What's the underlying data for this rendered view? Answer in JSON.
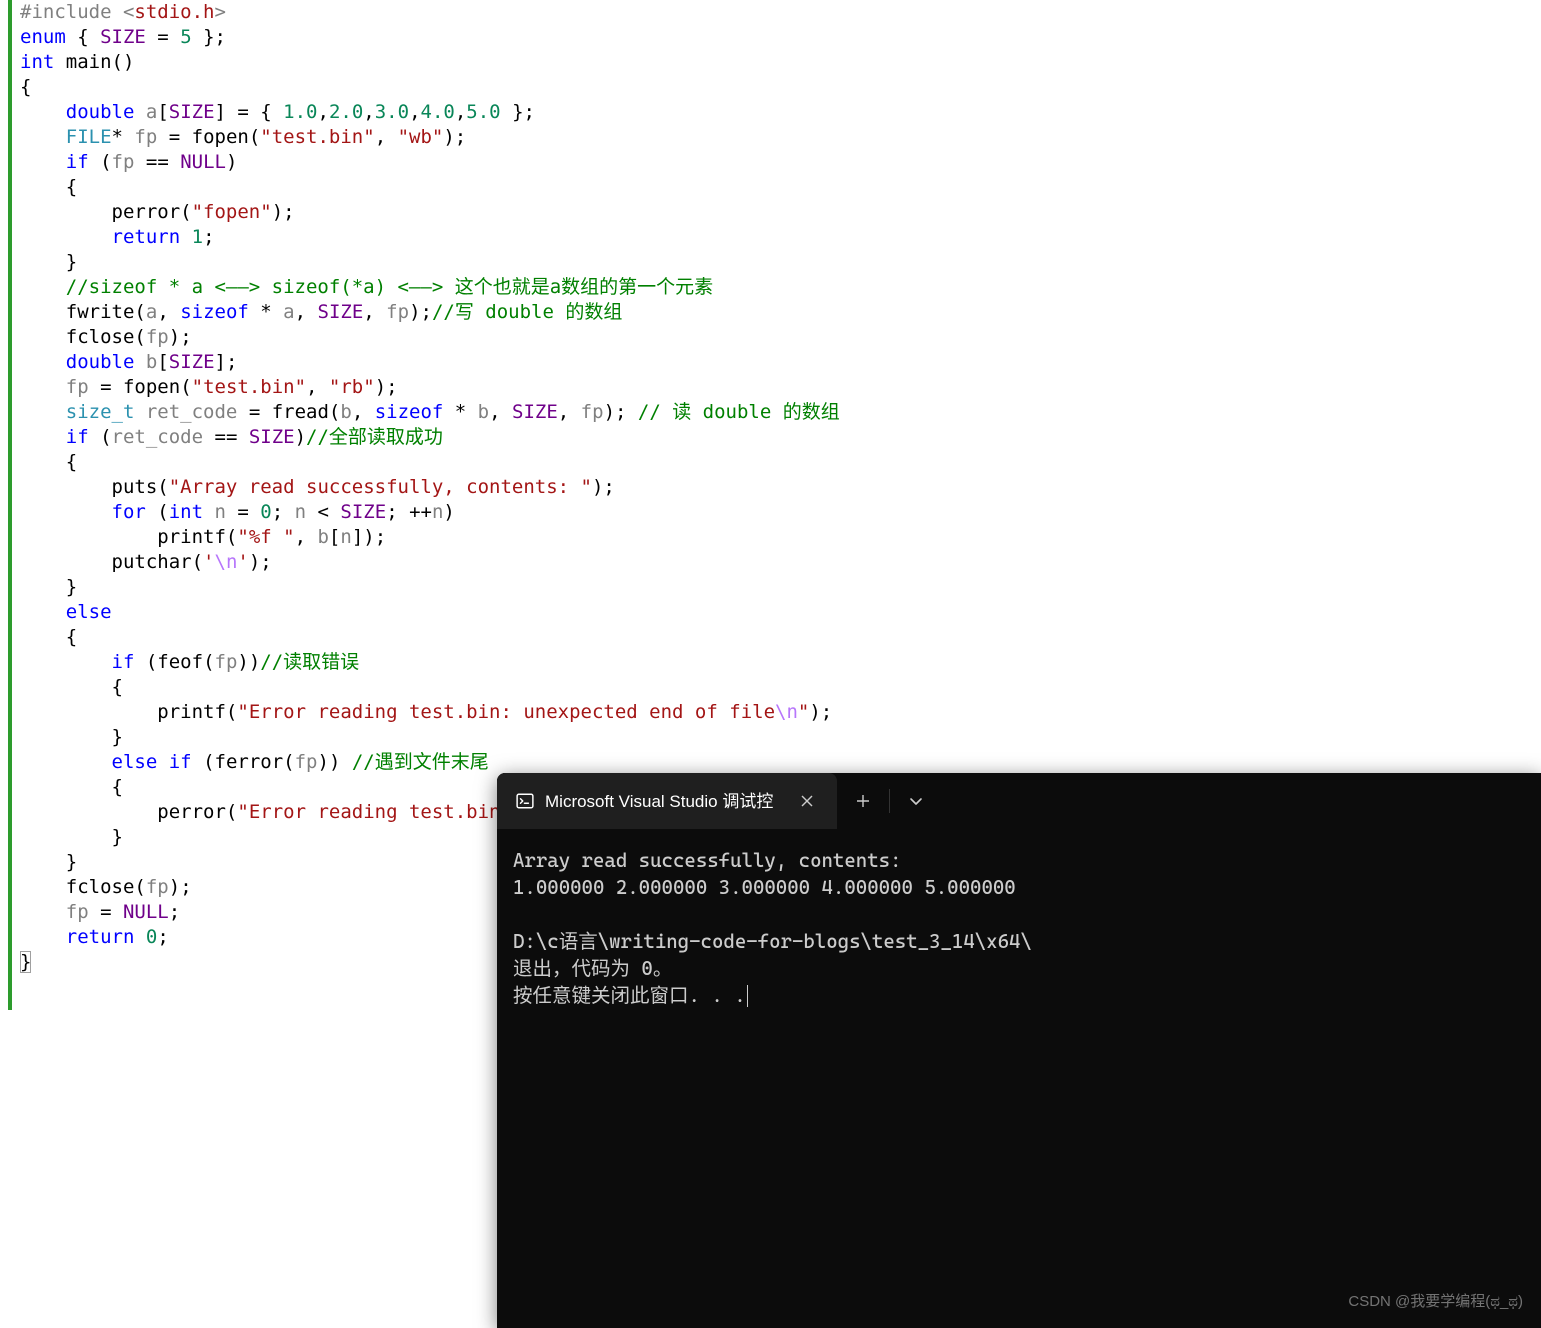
{
  "code": {
    "lines": [
      {
        "tokens": [
          [
            "pp",
            "#include "
          ],
          [
            "angle",
            "<"
          ],
          [
            "inc",
            "stdio.h"
          ],
          [
            "angle",
            ">"
          ]
        ]
      },
      {
        "tokens": [
          [
            "kw",
            "enum"
          ],
          [
            "op",
            " { "
          ],
          [
            "macro",
            "SIZE"
          ],
          [
            "op",
            " = "
          ],
          [
            "num",
            "5"
          ],
          [
            "op",
            " };"
          ]
        ]
      },
      {
        "tokens": [
          [
            "kw",
            "int"
          ],
          [
            "op",
            " "
          ],
          [
            "fn",
            "main"
          ],
          [
            "op",
            "()"
          ]
        ]
      },
      {
        "tokens": [
          [
            "op",
            "{"
          ]
        ]
      },
      {
        "tokens": [
          [
            "op",
            "    "
          ],
          [
            "kw",
            "double"
          ],
          [
            "op",
            " "
          ],
          [
            "id",
            "a"
          ],
          [
            "op",
            "["
          ],
          [
            "macro",
            "SIZE"
          ],
          [
            "op",
            "] = { "
          ],
          [
            "num",
            "1.0"
          ],
          [
            "op",
            ","
          ],
          [
            "num",
            "2.0"
          ],
          [
            "op",
            ","
          ],
          [
            "num",
            "3.0"
          ],
          [
            "op",
            ","
          ],
          [
            "num",
            "4.0"
          ],
          [
            "op",
            ","
          ],
          [
            "num",
            "5.0"
          ],
          [
            "op",
            " };"
          ]
        ]
      },
      {
        "tokens": [
          [
            "op",
            "    "
          ],
          [
            "up",
            "FILE"
          ],
          [
            "op",
            "* "
          ],
          [
            "id",
            "fp"
          ],
          [
            "op",
            " = "
          ],
          [
            "fn",
            "fopen"
          ],
          [
            "op",
            "("
          ],
          [
            "str",
            "\"test.bin\""
          ],
          [
            "op",
            ", "
          ],
          [
            "str",
            "\"wb\""
          ],
          [
            "op",
            ");"
          ]
        ]
      },
      {
        "tokens": [
          [
            "op",
            "    "
          ],
          [
            "kw",
            "if"
          ],
          [
            "op",
            " ("
          ],
          [
            "id",
            "fp"
          ],
          [
            "op",
            " == "
          ],
          [
            "macro",
            "NULL"
          ],
          [
            "op",
            ")"
          ]
        ]
      },
      {
        "tokens": [
          [
            "op",
            "    {"
          ]
        ]
      },
      {
        "tokens": [
          [
            "op",
            "        "
          ],
          [
            "fn",
            "perror"
          ],
          [
            "op",
            "("
          ],
          [
            "str",
            "\"fopen\""
          ],
          [
            "op",
            ");"
          ]
        ]
      },
      {
        "tokens": [
          [
            "op",
            "        "
          ],
          [
            "kw",
            "return"
          ],
          [
            "op",
            " "
          ],
          [
            "num",
            "1"
          ],
          [
            "op",
            ";"
          ]
        ]
      },
      {
        "tokens": [
          [
            "op",
            "    }"
          ]
        ]
      },
      {
        "tokens": [
          [
            "op",
            "    "
          ],
          [
            "cmt",
            "//sizeof * a <——> sizeof(*a) <——> 这个也就是a数组的第一个元素"
          ]
        ]
      },
      {
        "tokens": [
          [
            "op",
            "    "
          ],
          [
            "fn",
            "fwrite"
          ],
          [
            "op",
            "("
          ],
          [
            "id",
            "a"
          ],
          [
            "op",
            ", "
          ],
          [
            "kw",
            "sizeof"
          ],
          [
            "op",
            " * "
          ],
          [
            "id",
            "a"
          ],
          [
            "op",
            ", "
          ],
          [
            "macro",
            "SIZE"
          ],
          [
            "op",
            ", "
          ],
          [
            "id",
            "fp"
          ],
          [
            "op",
            ");"
          ],
          [
            "cmt",
            "//写 double 的数组"
          ]
        ]
      },
      {
        "tokens": [
          [
            "op",
            "    "
          ],
          [
            "fn",
            "fclose"
          ],
          [
            "op",
            "("
          ],
          [
            "id",
            "fp"
          ],
          [
            "op",
            ");"
          ]
        ]
      },
      {
        "tokens": [
          [
            "op",
            ""
          ]
        ]
      },
      {
        "tokens": [
          [
            "op",
            "    "
          ],
          [
            "kw",
            "double"
          ],
          [
            "op",
            " "
          ],
          [
            "id",
            "b"
          ],
          [
            "op",
            "["
          ],
          [
            "macro",
            "SIZE"
          ],
          [
            "op",
            "];"
          ]
        ]
      },
      {
        "tokens": [
          [
            "op",
            "    "
          ],
          [
            "id",
            "fp"
          ],
          [
            "op",
            " = "
          ],
          [
            "fn",
            "fopen"
          ],
          [
            "op",
            "("
          ],
          [
            "str",
            "\"test.bin\""
          ],
          [
            "op",
            ", "
          ],
          [
            "str",
            "\"rb\""
          ],
          [
            "op",
            ");"
          ]
        ]
      },
      {
        "tokens": [
          [
            "op",
            "    "
          ],
          [
            "up",
            "size_t"
          ],
          [
            "op",
            " "
          ],
          [
            "id",
            "ret_code"
          ],
          [
            "op",
            " = "
          ],
          [
            "fn",
            "fread"
          ],
          [
            "op",
            "("
          ],
          [
            "id",
            "b"
          ],
          [
            "op",
            ", "
          ],
          [
            "kw",
            "sizeof"
          ],
          [
            "op",
            " * "
          ],
          [
            "id",
            "b"
          ],
          [
            "op",
            ", "
          ],
          [
            "macro",
            "SIZE"
          ],
          [
            "op",
            ", "
          ],
          [
            "id",
            "fp"
          ],
          [
            "op",
            "); "
          ],
          [
            "cmt",
            "// 读 double 的数组"
          ]
        ]
      },
      {
        "tokens": [
          [
            "op",
            "    "
          ],
          [
            "kw",
            "if"
          ],
          [
            "op",
            " ("
          ],
          [
            "id",
            "ret_code"
          ],
          [
            "op",
            " == "
          ],
          [
            "macro",
            "SIZE"
          ],
          [
            "op",
            ")"
          ],
          [
            "cmt",
            "//全部读取成功"
          ]
        ]
      },
      {
        "tokens": [
          [
            "op",
            "    {"
          ]
        ]
      },
      {
        "tokens": [
          [
            "op",
            "        "
          ],
          [
            "fn",
            "puts"
          ],
          [
            "op",
            "("
          ],
          [
            "str",
            "\"Array read successfully, contents: \""
          ],
          [
            "op",
            ");"
          ]
        ]
      },
      {
        "tokens": [
          [
            "op",
            "        "
          ],
          [
            "kw",
            "for"
          ],
          [
            "op",
            " ("
          ],
          [
            "kw",
            "int"
          ],
          [
            "op",
            " "
          ],
          [
            "id",
            "n"
          ],
          [
            "op",
            " = "
          ],
          [
            "num",
            "0"
          ],
          [
            "op",
            "; "
          ],
          [
            "id",
            "n"
          ],
          [
            "op",
            " < "
          ],
          [
            "macro",
            "SIZE"
          ],
          [
            "op",
            "; ++"
          ],
          [
            "id",
            "n"
          ],
          [
            "op",
            ")"
          ]
        ]
      },
      {
        "tokens": [
          [
            "op",
            "            "
          ],
          [
            "fn",
            "printf"
          ],
          [
            "op",
            "("
          ],
          [
            "str",
            "\"%f \""
          ],
          [
            "op",
            ", "
          ],
          [
            "id",
            "b"
          ],
          [
            "op",
            "["
          ],
          [
            "id",
            "n"
          ],
          [
            "op",
            "]);"
          ]
        ]
      },
      {
        "tokens": [
          [
            "op",
            "        "
          ],
          [
            "fn",
            "putchar"
          ],
          [
            "op",
            "("
          ],
          [
            "str",
            "'"
          ],
          [
            "esc",
            "\\n"
          ],
          [
            "str",
            "'"
          ],
          [
            "op",
            ");"
          ]
        ]
      },
      {
        "tokens": [
          [
            "op",
            "    }"
          ]
        ]
      },
      {
        "tokens": [
          [
            "op",
            "    "
          ],
          [
            "kw",
            "else"
          ]
        ]
      },
      {
        "tokens": [
          [
            "op",
            "    {"
          ]
        ]
      },
      {
        "tokens": [
          [
            "op",
            "        "
          ],
          [
            "kw",
            "if"
          ],
          [
            "op",
            " ("
          ],
          [
            "fn",
            "feof"
          ],
          [
            "op",
            "("
          ],
          [
            "id",
            "fp"
          ],
          [
            "op",
            "))"
          ],
          [
            "cmt",
            "//读取错误"
          ]
        ]
      },
      {
        "tokens": [
          [
            "op",
            "        {"
          ]
        ]
      },
      {
        "tokens": [
          [
            "op",
            "            "
          ],
          [
            "fn",
            "printf"
          ],
          [
            "op",
            "("
          ],
          [
            "str",
            "\"Error reading test.bin: unexpected end of file"
          ],
          [
            "esc",
            "\\n"
          ],
          [
            "str",
            "\""
          ],
          [
            "op",
            ");"
          ]
        ]
      },
      {
        "tokens": [
          [
            "op",
            "        }"
          ]
        ]
      },
      {
        "tokens": [
          [
            "op",
            "        "
          ],
          [
            "kw",
            "else"
          ],
          [
            "op",
            " "
          ],
          [
            "kw",
            "if"
          ],
          [
            "op",
            " ("
          ],
          [
            "fn",
            "ferror"
          ],
          [
            "op",
            "("
          ],
          [
            "id",
            "fp"
          ],
          [
            "op",
            ")) "
          ],
          [
            "cmt",
            "//遇到文件末尾"
          ]
        ]
      },
      {
        "tokens": [
          [
            "op",
            "        {"
          ]
        ]
      },
      {
        "tokens": [
          [
            "op",
            "            "
          ],
          [
            "fn",
            "perror"
          ],
          [
            "op",
            "("
          ],
          [
            "str",
            "\"Error reading test.bin\""
          ],
          [
            "op",
            ");"
          ]
        ]
      },
      {
        "tokens": [
          [
            "op",
            "        }"
          ]
        ]
      },
      {
        "tokens": [
          [
            "op",
            "    }"
          ]
        ]
      },
      {
        "tokens": [
          [
            "op",
            "    "
          ],
          [
            "fn",
            "fclose"
          ],
          [
            "op",
            "("
          ],
          [
            "id",
            "fp"
          ],
          [
            "op",
            ");"
          ]
        ]
      },
      {
        "tokens": [
          [
            "op",
            "    "
          ],
          [
            "id",
            "fp"
          ],
          [
            "op",
            " = "
          ],
          [
            "macro",
            "NULL"
          ],
          [
            "op",
            ";"
          ]
        ]
      },
      {
        "tokens": [
          [
            "op",
            "    "
          ],
          [
            "kw",
            "return"
          ],
          [
            "op",
            " "
          ],
          [
            "num",
            "0"
          ],
          [
            "op",
            ";"
          ]
        ]
      },
      {
        "tokens": [
          [
            "brace-box",
            "}"
          ]
        ]
      }
    ]
  },
  "terminal": {
    "tab_title": "Microsoft Visual Studio 调试控",
    "output": {
      "line1": "Array read successfully, contents:",
      "line2": "1.000000 2.000000 3.000000 4.000000 5.000000",
      "blank": "",
      "line3": "D:\\c语言\\writing-code-for-blogs\\test_3_14\\x64\\",
      "line4": "退出，代码为 0。",
      "line5": "按任意键关闭此窗口. . ."
    }
  },
  "watermark": "CSDN @我要学编程(ಥ_ಥ)"
}
